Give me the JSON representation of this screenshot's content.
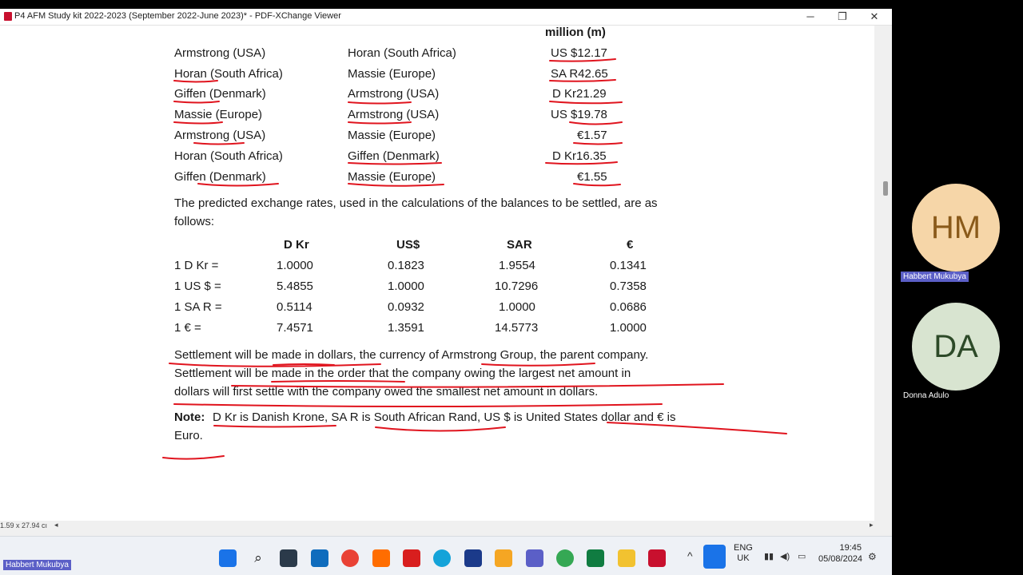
{
  "window": {
    "title": "P4 AFM Study kit 2022-2023 (September 2022-June 2023)* - PDF-XChange Viewer",
    "min_icon": "minimize-icon",
    "max_icon": "restore-icon",
    "close_icon": "close-icon"
  },
  "doc": {
    "col_header": "million (m)",
    "rows": [
      {
        "from": "Armstrong (USA)",
        "to": "Horan (South Africa)",
        "amount": "US $12.17"
      },
      {
        "from": "Horan (South Africa)",
        "to": "Massie (Europe)",
        "amount": "SA R42.65"
      },
      {
        "from": "Giffen (Denmark)",
        "to": "Armstrong (USA)",
        "amount": "D Kr21.29"
      },
      {
        "from": "Massie (Europe)",
        "to": "Armstrong (USA)",
        "amount": "US $19.78"
      },
      {
        "from": "Armstrong (USA)",
        "to": "Massie (Europe)",
        "amount": "€1.57"
      },
      {
        "from": "Horan (South Africa)",
        "to": "Giffen (Denmark)",
        "amount": "D Kr16.35"
      },
      {
        "from": "Giffen (Denmark)",
        "to": "Massie (Europe)",
        "amount": "€1.55"
      }
    ],
    "para1_l1": "The predicted exchange rates, used in the calculations of the balances to be settled, are as",
    "para1_l2": "follows:",
    "rate_headers": [
      "D Kr",
      "US$",
      "SAR",
      "€"
    ],
    "rates": [
      {
        "label": "1 D Kr =",
        "v": [
          "1.0000",
          "0.1823",
          "1.9554",
          "0.1341"
        ]
      },
      {
        "label": "1 US $ =",
        "v": [
          "5.4855",
          "1.0000",
          "10.7296",
          "0.7358"
        ]
      },
      {
        "label": "1 SA R =",
        "v": [
          "0.5114",
          "0.0932",
          "1.0000",
          "0.0686"
        ]
      },
      {
        "label": "1 € =",
        "v": [
          "7.4571",
          "1.3591",
          "14.5773",
          "1.0000"
        ]
      }
    ],
    "para2_l1": "Settlement will be made in dollars, the currency of Armstrong Group, the parent company.",
    "para2_l2": "Settlement will be made in the order that the company owing the largest net amount in",
    "para2_l3": "dollars will first settle with the company owed the smallest net amount in dollars.",
    "note_label": "Note:",
    "note_l1": "D Kr is Danish Krone, SA R is South African Rand, US $ is United States dollar and € is",
    "note_l2": "Euro.",
    "annotation_color": "#e0141e"
  },
  "status": {
    "page_size": "1.59 x 27.94 cı"
  },
  "taskbar": {
    "icons": [
      "windows-start-icon",
      "search-icon",
      "notepad-icon",
      "outlook-icon",
      "chrome-icon",
      "search-app-icon",
      "adobe-icon",
      "edge-icon",
      "whiteboard-icon",
      "paint-icon",
      "teams-icon",
      "maps-icon",
      "excel-icon",
      "file-explorer-icon",
      "pdf-xchange-icon"
    ],
    "lang1": "ENG",
    "lang2": "UK",
    "time": "19:45",
    "date": "05/08/2024"
  },
  "participants": [
    {
      "initials": "HM",
      "name": "Habbert Mukubya",
      "bg": "#f6d6a8",
      "fg": "#8a5a1a"
    },
    {
      "initials": "DA",
      "name": "Donna Adulo",
      "bg": "#d8e4d0",
      "fg": "#2d4a28"
    }
  ],
  "self_label": "Habbert Mukubya"
}
